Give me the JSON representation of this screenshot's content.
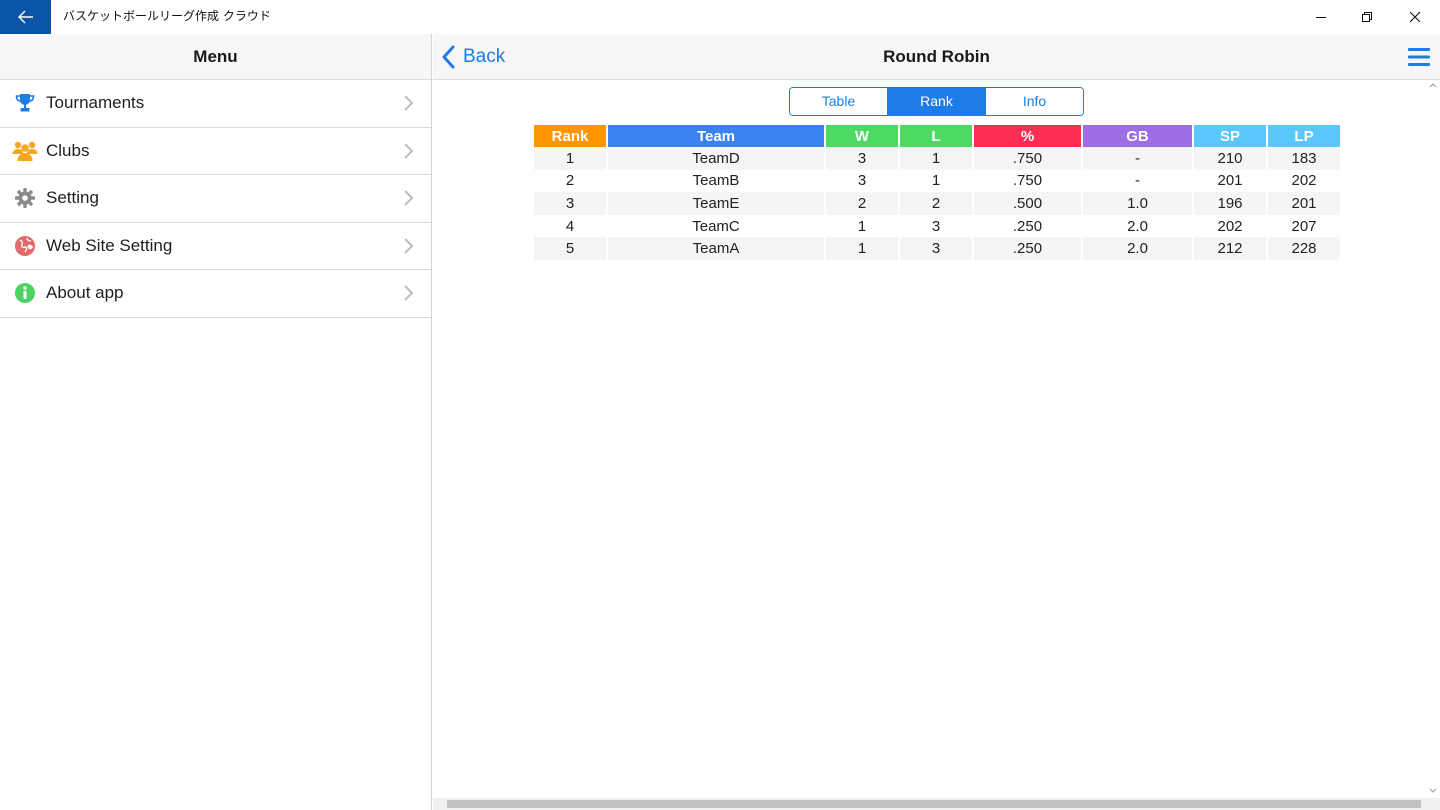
{
  "window": {
    "title": "バスケットボールリーグ作成 クラウド"
  },
  "sidebar": {
    "header": "Menu",
    "items": [
      {
        "label": "Tournaments",
        "icon": "trophy-icon",
        "color": "#1e7ce6"
      },
      {
        "label": "Clubs",
        "icon": "people-icon",
        "color": "#f5a623"
      },
      {
        "label": "Setting",
        "icon": "gear-icon",
        "color": "#8a8a8a"
      },
      {
        "label": "Web Site Setting",
        "icon": "globe-icon",
        "color": "#e26a6a"
      },
      {
        "label": "About app",
        "icon": "info-icon",
        "color": "#4cd264"
      }
    ]
  },
  "main": {
    "back_label": "Back",
    "title": "Round Robin",
    "tabs": [
      "Table",
      "Rank",
      "Info"
    ],
    "active_tab": "Rank",
    "standings": {
      "columns": [
        {
          "label": "Rank",
          "color": "#ff9500",
          "width": 72
        },
        {
          "label": "Team",
          "color": "#3b82f0",
          "width": 216
        },
        {
          "label": "W",
          "color": "#4cd964",
          "width": 72
        },
        {
          "label": "L",
          "color": "#4cd964",
          "width": 72
        },
        {
          "label": "%",
          "color": "#ff2d55",
          "width": 107
        },
        {
          "label": "GB",
          "color": "#9b6ee6",
          "width": 109
        },
        {
          "label": "SP",
          "color": "#5ac8fa",
          "width": 72
        },
        {
          "label": "LP",
          "color": "#5ac8fa",
          "width": 72
        }
      ],
      "rows": [
        [
          "1",
          "TeamD",
          "3",
          "1",
          ".750",
          "-",
          "210",
          "183"
        ],
        [
          "2",
          "TeamB",
          "3",
          "1",
          ".750",
          "-",
          "201",
          "202"
        ],
        [
          "3",
          "TeamE",
          "2",
          "2",
          ".500",
          "1.0",
          "196",
          "201"
        ],
        [
          "4",
          "TeamC",
          "1",
          "3",
          ".250",
          "2.0",
          "202",
          "207"
        ],
        [
          "5",
          "TeamA",
          "1",
          "3",
          ".250",
          "2.0",
          "212",
          "228"
        ]
      ]
    }
  },
  "accent": "#1e7ce6",
  "titlebar_back_color": "#0a55a6"
}
